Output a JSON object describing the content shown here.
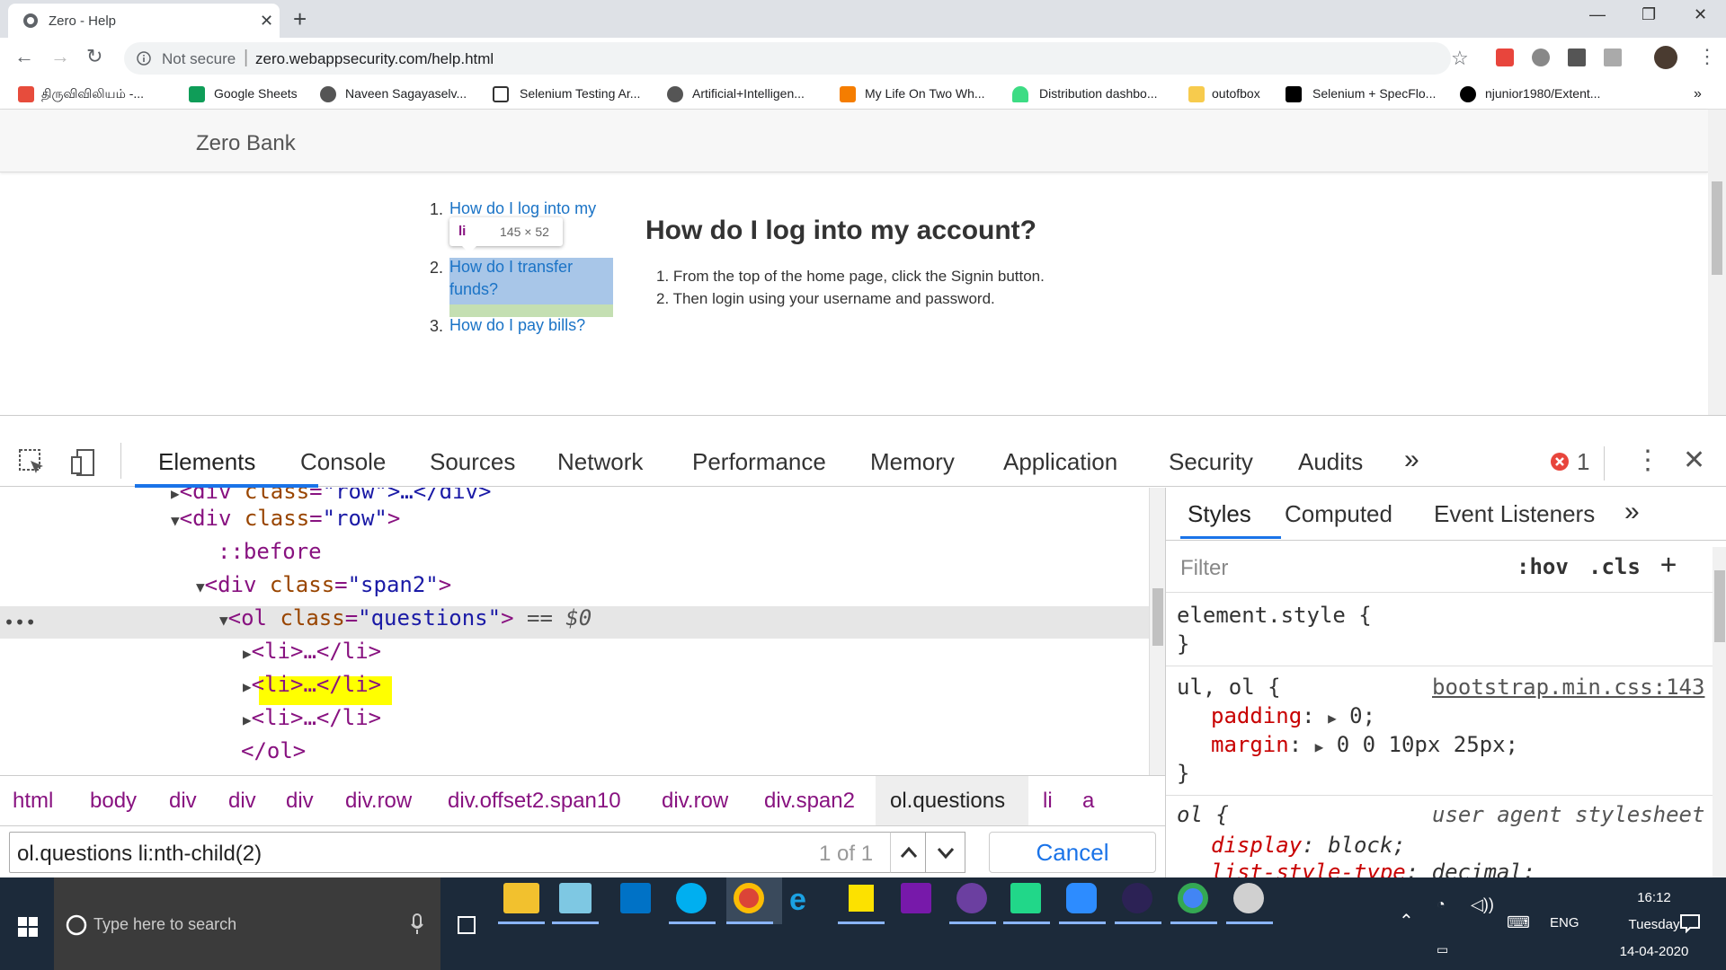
{
  "browser": {
    "tab_title": "Zero - Help",
    "url_prefix": "Not secure",
    "url": "zero.webappsecurity.com/help.html"
  },
  "bookmarks": [
    {
      "label": "திருவிவிலியம் -...",
      "icon_color": "#e74c3c"
    },
    {
      "label": "Google Sheets",
      "icon_color": "#0f9d58"
    },
    {
      "label": "Naveen Sagayaselv...",
      "icon_color": "#555555"
    },
    {
      "label": "Selenium Testing Ar...",
      "icon_color": "#333333"
    },
    {
      "label": "Artificial+Intelligen...",
      "icon_color": "#555555"
    },
    {
      "label": "My Life On Two Wh...",
      "icon_color": "#f57d00"
    },
    {
      "label": "Distribution dashbo...",
      "icon_color": "#3ddc84"
    },
    {
      "label": "outofbox",
      "icon_color": "#f7cb4d"
    },
    {
      "label": "Selenium + SpecFlo...",
      "icon_color": "#000000"
    },
    {
      "label": "njunior1980/Extent...",
      "icon_color": "#000000"
    }
  ],
  "page": {
    "brand": "Zero Bank",
    "questions": [
      {
        "num": "1.",
        "text_line1": "How do I log into my",
        "text_line2": ""
      },
      {
        "num": "2.",
        "text_line1": "How do I transfer",
        "text_line2": "funds?"
      },
      {
        "num": "3.",
        "text_line1": "How do I pay bills?",
        "text_line2": ""
      }
    ],
    "tooltip_tag": "li",
    "tooltip_size": "145 × 52",
    "answer_title": "How do I log into my account?",
    "answer_steps": [
      "1. From the top of the home page, click the Signin button.",
      "2. Then login using your username and password."
    ]
  },
  "devtools": {
    "tabs": [
      "Elements",
      "Console",
      "Sources",
      "Network",
      "Performance",
      "Memory",
      "Application",
      "Security",
      "Audits"
    ],
    "active_tab": "Elements",
    "error_count": "1",
    "dom": {
      "row_collapsed": "\"row\">…</div>",
      "row_class": "\"row\"",
      "before": "::before",
      "span_class": "\"span2\"",
      "ol_class": "\"questions\"",
      "ol_suffix": " == $0",
      "li_text": "<li>…</li>",
      "ol_close": "</ol>"
    },
    "breadcrumbs": [
      "html",
      "body",
      "div",
      "div",
      "div",
      "div.row",
      "div.offset2.span10",
      "div.row",
      "div.span2",
      "ol.questions",
      "li",
      "a"
    ],
    "search": {
      "query": "ol.questions li:nth-child(2)",
      "count": "1 of 1",
      "cancel_label": "Cancel"
    },
    "styles": {
      "tabs": [
        "Styles",
        "Computed",
        "Event Listeners"
      ],
      "filter_placeholder": "Filter",
      "hov": ":hov",
      "cls": ".cls",
      "element_style": "element.style {",
      "close_brace": "}",
      "rule1_selector": "ul, ol {",
      "rule1_source": "bootstrap.min.css:143",
      "rule1_prop1": "padding",
      "rule1_val1": "0;",
      "rule1_prop2": "margin",
      "rule1_val2": "0 0 10px 25px;",
      "rule2_selector": "ol {",
      "rule2_source": "user agent stylesheet",
      "rule2_prop1": "display",
      "rule2_val1": "block;",
      "rule2_prop2": "list-style-type",
      "rule2_val2": "decimal;"
    }
  },
  "taskbar": {
    "search_placeholder": "Type here to search",
    "lang": "ENG",
    "time": "16:12",
    "day": "Tuesday",
    "date": "14-04-2020"
  }
}
